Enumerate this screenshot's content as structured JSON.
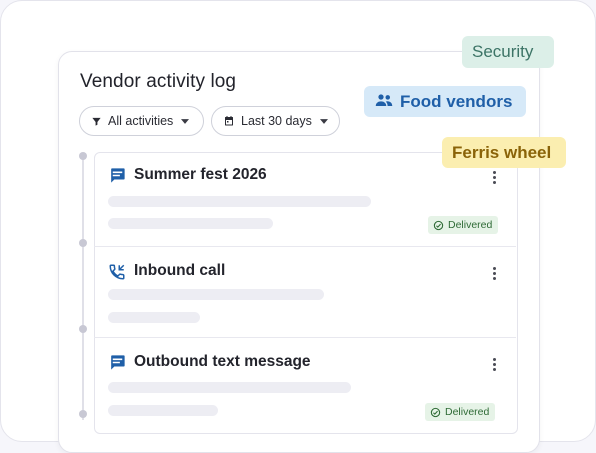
{
  "header": {
    "title": "Vendor activity log"
  },
  "filters": [
    {
      "label": "All activities",
      "icon": "filter-icon"
    },
    {
      "label": "Last 30 days",
      "icon": "calendar-icon"
    }
  ],
  "activities": [
    {
      "title": "Summer fest 2026",
      "icon": "message-icon",
      "status": "Delivered"
    },
    {
      "title": "Inbound call",
      "icon": "phone-incoming-icon",
      "status": ""
    },
    {
      "title": "Outbound text message",
      "icon": "message-icon",
      "status": "Delivered"
    }
  ],
  "tags": {
    "security": "Security",
    "food_vendors": "Food vendors",
    "ferris_wheel": "Ferris wheel"
  },
  "colors": {
    "accent": "#1f5fa8",
    "security_bg": "#dcefe8",
    "food_vendors_bg": "#d6e9f8",
    "ferris_wheel_bg": "#fbeeb0",
    "delivered_bg": "#e6f3e7"
  }
}
